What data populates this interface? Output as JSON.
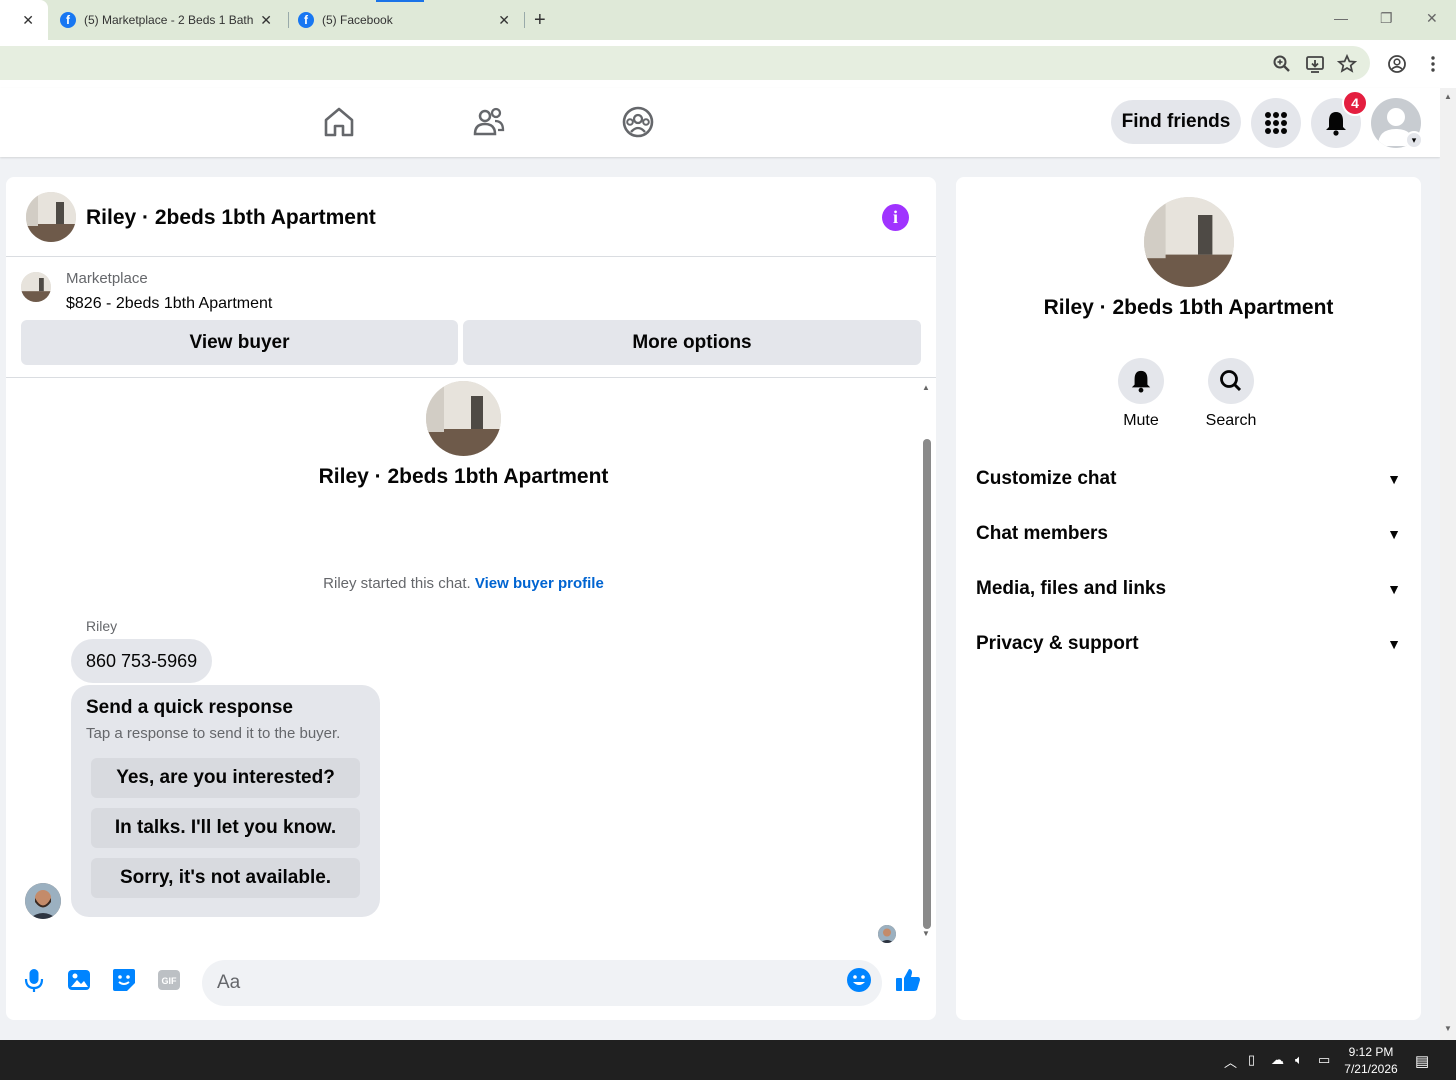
{
  "browser": {
    "tabs": [
      {
        "label": ""
      },
      {
        "label": "(5) Marketplace - 2 Beds 1 Bath"
      },
      {
        "label": "(5) Facebook"
      }
    ],
    "new_tab": "+"
  },
  "nav": {
    "find_friends": "Find friends",
    "notification_count": "4"
  },
  "chat": {
    "title": "Riley · 2beds 1bth Apartment",
    "listing_source": "Marketplace",
    "listing_title": "$826 - 2beds 1bth Apartment",
    "view_buyer": "View buyer",
    "more_options": "More options",
    "center_name": "Riley · 2beds 1bth Apartment",
    "started_text": "Riley started this chat.",
    "view_buyer_profile": "View buyer profile",
    "sender": "Riley",
    "phone_message": "860 753-5969",
    "quick_title": "Send a quick response",
    "quick_subtitle": "Tap a response to send it to the buyer.",
    "quick_responses": [
      "Yes, are you interested?",
      "In talks. I'll let you know.",
      "Sorry, it's not available."
    ],
    "input_placeholder": "Aa"
  },
  "info": {
    "name": "Riley · 2beds 1bth Apartment",
    "mute": "Mute",
    "search": "Search",
    "sections": [
      "Customize chat",
      "Chat members",
      "Media, files and links",
      "Privacy & support"
    ]
  },
  "taskbar": {
    "time": "9:12 PM",
    "date": "7/21/2026"
  },
  "colors": {
    "accent": "#0084ff",
    "info_purple": "#a033ff",
    "badge_red": "#e41e3f"
  }
}
